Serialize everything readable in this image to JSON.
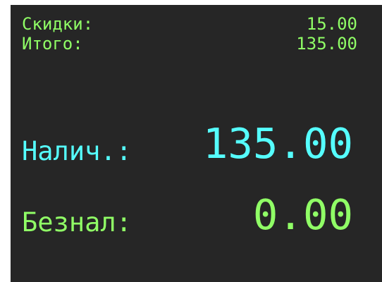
{
  "summary": {
    "discount_label": "Скидки:",
    "discount_value": "15.00",
    "total_label": "Итого:",
    "total_value": "135.00"
  },
  "payment": {
    "cash_label": "Налич.:",
    "cash_value": "135.00",
    "cashless_label": "Безнал:",
    "cashless_value": "0.00"
  },
  "colors": {
    "background": "#262626",
    "green_text": "#90ff66",
    "cyan_text": "#55ffff"
  }
}
